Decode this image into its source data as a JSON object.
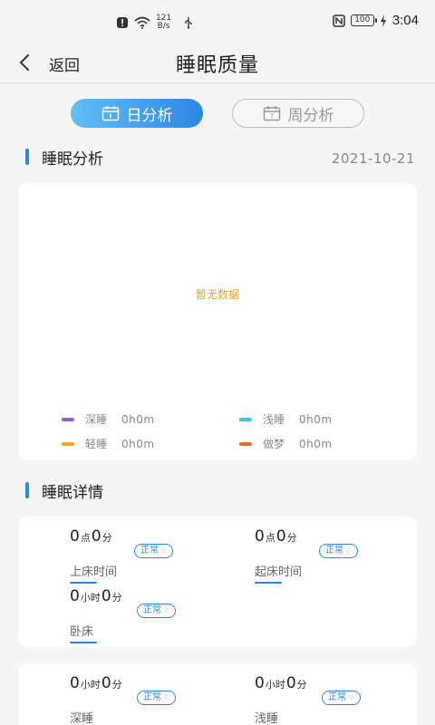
{
  "status_bar": {
    "net_speed_value": "121",
    "net_speed_unit": "B/s",
    "battery": "100",
    "time": "3:04"
  },
  "header": {
    "back_label": "返回",
    "title": "睡眠质量"
  },
  "tabs": {
    "day": "日分析",
    "week": "周分析",
    "week_icon_digit": "7"
  },
  "analysis": {
    "title": "睡眠分析",
    "date": "2021-10-21",
    "no_data": "暂无数据",
    "legend": [
      {
        "name": "深睡",
        "value": "0h0m",
        "color": "#8e5fd8"
      },
      {
        "name": "浅睡",
        "value": "0h0m",
        "color": "#35c9e6"
      },
      {
        "name": "轻睡",
        "value": "0h0m",
        "color": "#f5a623"
      },
      {
        "name": "做梦",
        "value": "0h0m",
        "color": "#ee6a28"
      }
    ]
  },
  "details": {
    "title": "睡眠详情",
    "badge": "正常",
    "units": {
      "dian": "点",
      "fen": "分",
      "xiaoshi": "小时"
    },
    "bedtime": {
      "h": "0",
      "m": "0",
      "label": "上床时间"
    },
    "wakeup": {
      "h": "0",
      "m": "0",
      "label": "起床时间"
    },
    "inbed": {
      "h": "0",
      "m": "0",
      "label": "卧床"
    },
    "deep": {
      "h": "0",
      "m": "0",
      "label": "深睡"
    },
    "light": {
      "h": "0",
      "m": "0",
      "label": "浅睡"
    }
  },
  "colors": {
    "accent": "#2e86e4",
    "no_data": "#e0a52a"
  }
}
